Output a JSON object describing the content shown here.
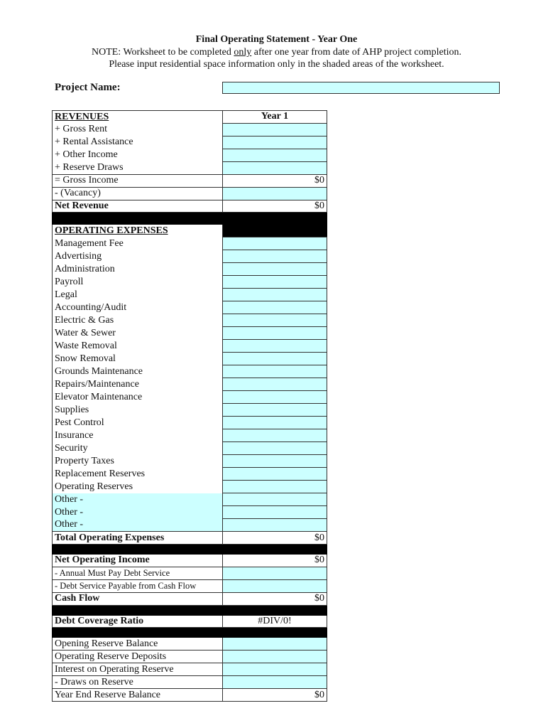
{
  "header": {
    "title": "Final Operating Statement - Year One",
    "note_prefix": "NOTE:  Worksheet to be completed ",
    "note_emph": "only",
    "note_suffix": " after one year from date of AHP project completion.",
    "note_line2": "Please input residential space information only in the shaded areas of the worksheet."
  },
  "project": {
    "label": "Project Name:",
    "value": ""
  },
  "table": {
    "column_header": "Year 1",
    "revenues": {
      "heading": "REVENUES",
      "inputs": [
        {
          "label": "+ Gross Rent",
          "value": ""
        },
        {
          "label": "+ Rental Assistance",
          "value": ""
        },
        {
          "label": "+ Other Income",
          "value": ""
        },
        {
          "label": "+ Reserve Draws",
          "value": ""
        }
      ],
      "gross_income": {
        "label": "= Gross Income",
        "value": "$0"
      },
      "vacancy": {
        "label": "- (Vacancy)",
        "value": ""
      },
      "net_revenue": {
        "label": "Net Revenue",
        "value": "$0"
      }
    },
    "expenses": {
      "heading": "OPERATING EXPENSES",
      "items": [
        {
          "label": "Management Fee",
          "value": ""
        },
        {
          "label": "Advertising",
          "value": ""
        },
        {
          "label": "Administration",
          "value": ""
        },
        {
          "label": "Payroll",
          "value": ""
        },
        {
          "label": "Legal",
          "value": ""
        },
        {
          "label": "Accounting/Audit",
          "value": ""
        },
        {
          "label": "Electric & Gas",
          "value": ""
        },
        {
          "label": "Water & Sewer",
          "value": ""
        },
        {
          "label": "Waste Removal",
          "value": ""
        },
        {
          "label": "Snow Removal",
          "value": ""
        },
        {
          "label": "Grounds Maintenance",
          "value": ""
        },
        {
          "label": "Repairs/Maintenance",
          "value": ""
        },
        {
          "label": "Elevator Maintenance",
          "value": ""
        },
        {
          "label": "Supplies",
          "value": ""
        },
        {
          "label": "Pest Control",
          "value": ""
        },
        {
          "label": "Insurance",
          "value": ""
        },
        {
          "label": "Security",
          "value": ""
        },
        {
          "label": "Property Taxes",
          "value": ""
        },
        {
          "label": "Replacement Reserves",
          "value": ""
        },
        {
          "label": "Operating Reserves",
          "value": ""
        }
      ],
      "others": [
        {
          "label": "Other -",
          "value": ""
        },
        {
          "label": "Other -",
          "value": ""
        },
        {
          "label": "Other -",
          "value": ""
        }
      ],
      "total": {
        "label": "Total Operating Expenses",
        "value": "$0"
      }
    },
    "noi": {
      "label": "Net Operating Income",
      "value": "$0"
    },
    "debt": [
      {
        "label": "- Annual Must Pay Debt Service",
        "value": ""
      },
      {
        "label": "- Debt Service Payable from Cash Flow",
        "value": ""
      }
    ],
    "cash_flow": {
      "label": "Cash Flow",
      "value": "$0"
    },
    "dcr": {
      "label": "Debt Coverage Ratio",
      "value": "#DIV/0!"
    },
    "reserves": [
      {
        "label": "Opening Reserve Balance",
        "value": ""
      },
      {
        "label": "Operating Reserve Deposits",
        "value": ""
      },
      {
        "label": "Interest on Operating Reserve",
        "value": ""
      },
      {
        "label": "- Draws on Reserve",
        "value": ""
      }
    ],
    "year_end": {
      "label": "Year End Reserve Balance",
      "value": "$0"
    }
  },
  "colors": {
    "input_shade": "#ccffff",
    "separator": "#000000",
    "border": "#333333"
  }
}
